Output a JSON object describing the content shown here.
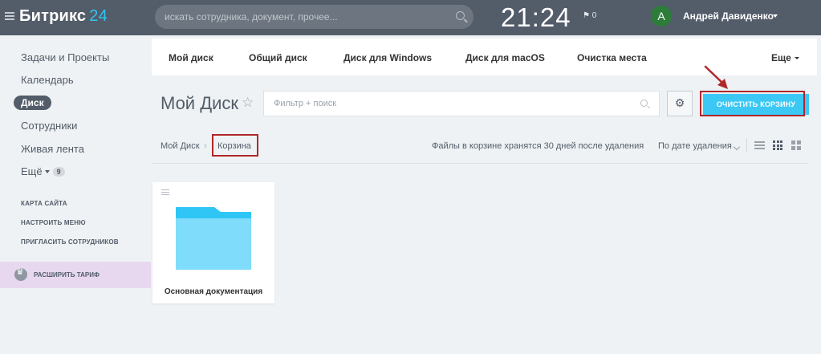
{
  "header": {
    "logo_text": "Битрикс",
    "logo_num": "24",
    "search_placeholder": "искать сотрудника, документ, прочее...",
    "time": "21:24",
    "flag_text": "⚑ 0",
    "avatar_letter": "А",
    "user_name": "Андрей Давиденко"
  },
  "sidebar": {
    "items": [
      {
        "label": "Задачи и Проекты"
      },
      {
        "label": "Календарь"
      },
      {
        "label": "Диск"
      },
      {
        "label": "Сотрудники"
      },
      {
        "label": "Живая лента"
      },
      {
        "label": "Ещё"
      }
    ],
    "more_badge": "9",
    "small_links": [
      {
        "label": "КАРТА САЙТА"
      },
      {
        "label": "НАСТРОИТЬ МЕНЮ"
      },
      {
        "label": "ПРИГЛАСИТЬ СОТРУДНИКОВ"
      }
    ],
    "upgrade_label": "РАСШИРИТЬ ТАРИФ"
  },
  "tabs": [
    {
      "label": "Мой диск"
    },
    {
      "label": "Общий диск"
    },
    {
      "label": "Диск для Windows"
    },
    {
      "label": "Диск для macOS"
    },
    {
      "label": "Очистка места"
    },
    {
      "label": "Еще"
    }
  ],
  "main": {
    "title": "Мой Диск",
    "filter_placeholder": "Фильтр + поиск",
    "clear_button": "ОЧИСТИТЬ КОРЗИНУ",
    "breadcrumb": [
      "Мой Диск",
      "Корзина"
    ],
    "note": "Файлы в корзине хранятся 30 дней после удаления",
    "sort_label": "По дате удаления",
    "folder_name": "Основная документация"
  },
  "colors": {
    "topbar": "#535c69",
    "accent": "#3bc8f5",
    "highlight_red": "#b0272a"
  }
}
